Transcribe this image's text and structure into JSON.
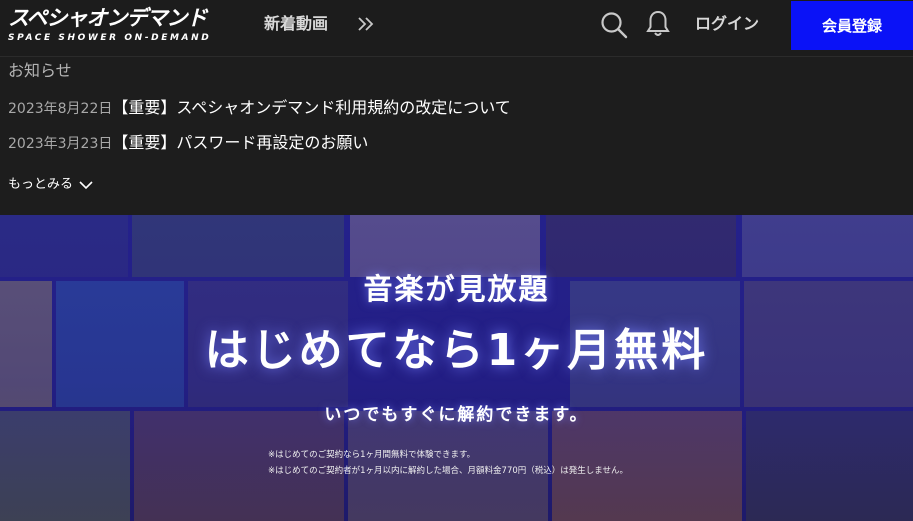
{
  "header": {
    "logo_main": "スペシャオンデマンド",
    "logo_sub": "SPACE SHOWER ON-DEMAND",
    "nav_new": "新着動画",
    "login": "ログイン",
    "signup": "会員登録"
  },
  "notices": {
    "title": "お知らせ",
    "items": [
      {
        "date": "2023年8月22日",
        "text": "【重要】スペシャオンデマンド利用規約の改定について"
      },
      {
        "date": "2023年3月23日",
        "text": "【重要】パスワード再設定のお願い"
      }
    ],
    "more": "もっとみる"
  },
  "hero": {
    "headline": "音楽が見放題",
    "main": "はじめてなら1ヶ月無料",
    "sub": "いつでもすぐに解約できます。",
    "notes": [
      "※はじめてのご契約なら1ヶ月間無料で体験できます。",
      "※はじめてのご契約者が1ヶ月以内に解約した場合、月額料金770円（税込）は発生しません。"
    ]
  },
  "colors": {
    "header_bg": "#1c1c1c",
    "signup_bg": "#0a12f7",
    "hero_tint": "#2a26aa"
  }
}
